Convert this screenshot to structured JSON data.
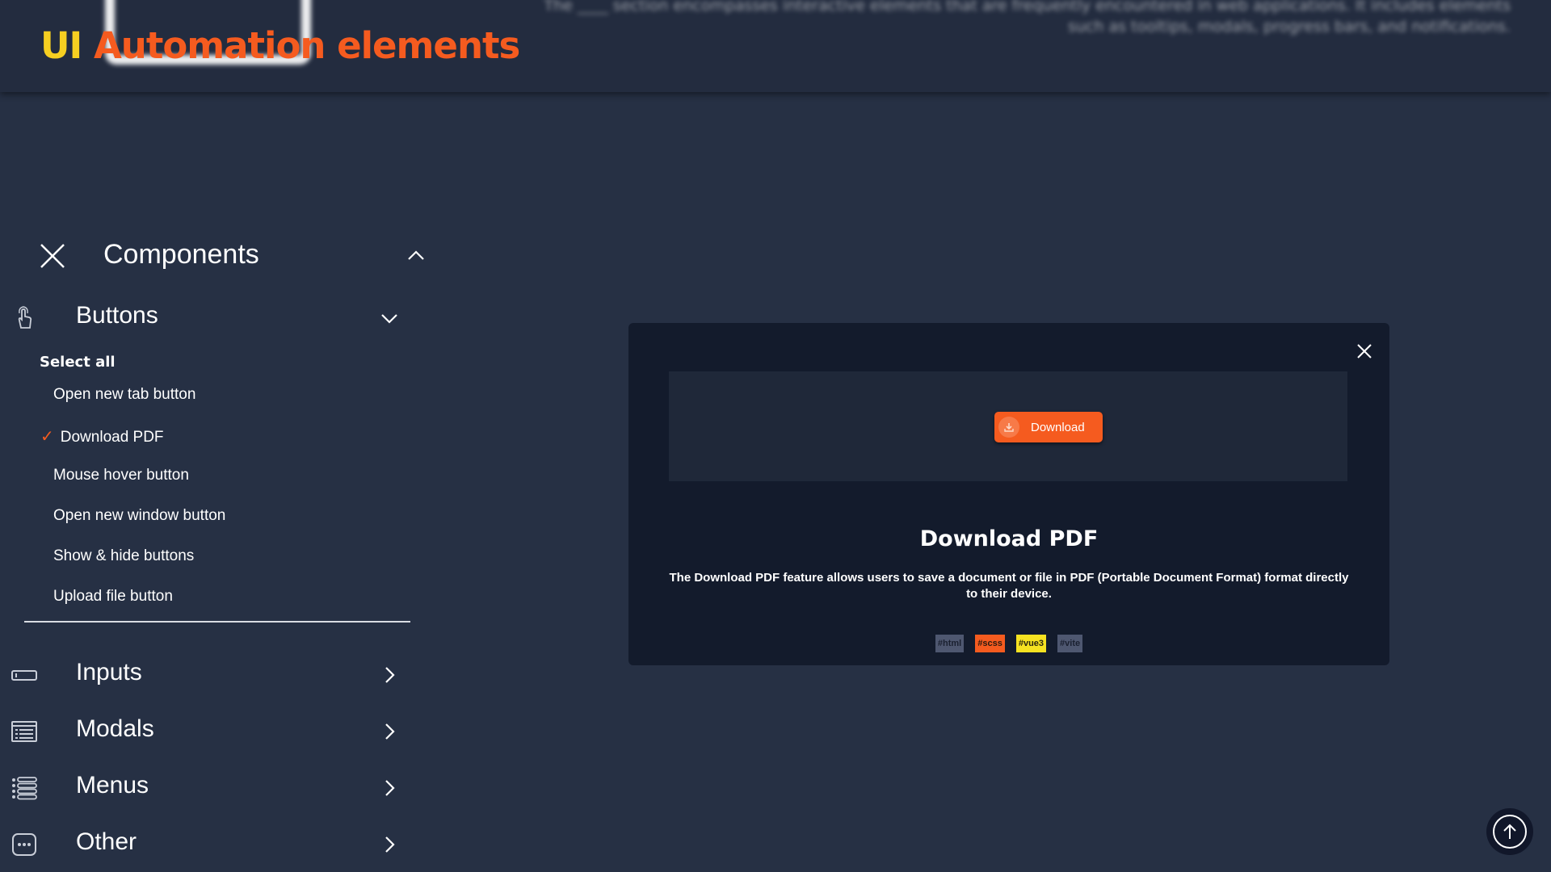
{
  "header": {
    "brand_ui": "UI",
    "brand_rest": "Automation elements",
    "blurred_intro_line1": "The ____ section encompasses interactive elements that are frequently encountered in web applications. It includes elements",
    "blurred_intro_line2": "such as tooltips, modals, progress bars, and notifications."
  },
  "sidebar": {
    "section_title": "Components",
    "buttons_category": {
      "label": "Buttons",
      "select_all": "Select all",
      "items": [
        {
          "label": "Open new tab button",
          "checked": false
        },
        {
          "label": "Download PDF",
          "checked": true
        },
        {
          "label": "Mouse hover button",
          "checked": false
        },
        {
          "label": "Open new window button",
          "checked": false
        },
        {
          "label": "Show & hide buttons",
          "checked": false
        },
        {
          "label": "Upload file button",
          "checked": false
        }
      ],
      "check_mark": "✓"
    },
    "categories": [
      {
        "label": "Inputs",
        "icon": "input-field-icon"
      },
      {
        "label": "Modals",
        "icon": "modal-list-icon"
      },
      {
        "label": "Menus",
        "icon": "menu-list-icon"
      },
      {
        "label": "Other",
        "icon": "more-dots-icon"
      }
    ]
  },
  "card": {
    "download_button_label": "Download",
    "title": "Download PDF",
    "description": "The Download PDF feature allows users to save a document or file in PDF (Portable Document Format) format directly to their device.",
    "tags": [
      "#html",
      "#scss",
      "#vue3",
      "#vite"
    ]
  },
  "colors": {
    "accent_orange": "#f55b1f",
    "accent_yellow": "#f6cf21",
    "background": "#263044",
    "card_background": "#131b2c"
  }
}
